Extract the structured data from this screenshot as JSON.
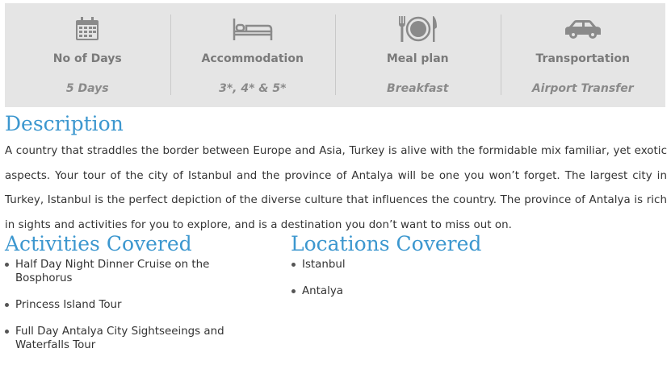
{
  "info_bar": {
    "cells": [
      {
        "icon": "calendar-icon",
        "label": "No of Days",
        "value": "5 Days"
      },
      {
        "icon": "bed-icon",
        "label": "Accommodation",
        "value": "3*, 4* & 5*"
      },
      {
        "icon": "meal-plate-icon",
        "label": "Meal plan",
        "value": "Breakfast"
      },
      {
        "icon": "car-icon",
        "label": "Transportation",
        "value": "Airport Transfer"
      }
    ],
    "icon_color": "#8a8a8a",
    "background": "#e5e5e5"
  },
  "description": {
    "title": "Description",
    "text": "A country that straddles the border between Europe and Asia, Turkey is alive with the formidable mix familiar, yet exotic aspects. Your tour of the city of Istanbul and the province of Antalya will be one you won’t forget. The largest city in Turkey, Istanbul is the perfect depiction of the diverse culture that influences the country. The province of Antalya is rich in sights and activities for you to explore, and is a destination you don’t want to miss out on."
  },
  "activities": {
    "title": "Activities Covered",
    "items": [
      "Half Day Night Dinner Cruise on the Bosphorus",
      "Princess Island Tour",
      "Full Day Antalya City Sightseeings and Waterfalls Tour"
    ]
  },
  "locations": {
    "title": "Locations Covered",
    "items": [
      "Istanbul",
      "Antalya"
    ]
  },
  "colors": {
    "heading": "#3c97cf",
    "body_text": "#333333"
  }
}
